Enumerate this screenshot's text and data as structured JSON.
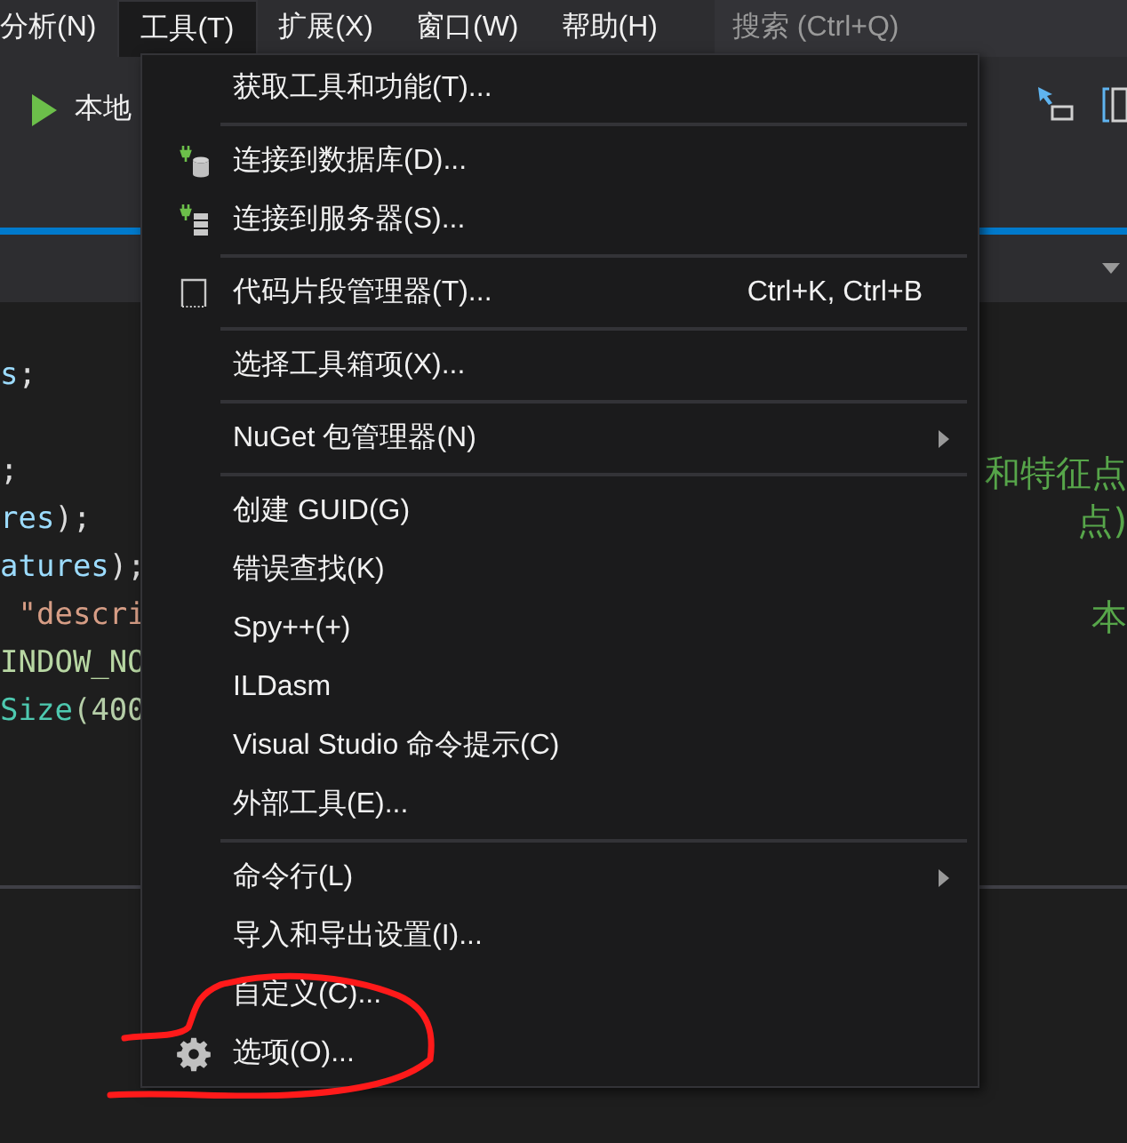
{
  "menubar": {
    "items": [
      {
        "label": "分析(N)",
        "selected": false
      },
      {
        "label": "工具(T)",
        "selected": true
      },
      {
        "label": "扩展(X)",
        "selected": false
      },
      {
        "label": "窗口(W)",
        "selected": false
      },
      {
        "label": "帮助(H)",
        "selected": false
      }
    ],
    "search": {
      "placeholder": "搜索 (Ctrl+Q)"
    }
  },
  "toolbar": {
    "run_label": "本地"
  },
  "editor": {
    "lines": [
      {
        "kind": "code",
        "left": [
          {
            "text": "s",
            "color": "#9cdcfe"
          },
          {
            "text": ";",
            "color": "#dcdcdc"
          }
        ]
      },
      {
        "kind": "blank"
      },
      {
        "kind": "code",
        "left": [
          {
            "text": ";",
            "color": "#dcdcdc"
          }
        ],
        "right": [
          {
            "text": "和特征点",
            "color": "#57a64a"
          }
        ]
      },
      {
        "kind": "code",
        "left": [
          {
            "text": "res",
            "color": "#9cdcfe"
          },
          {
            "text": ");",
            "color": "#dcdcdc"
          }
        ],
        "right": [
          {
            "text": "点)",
            "color": "#57a64a"
          }
        ]
      },
      {
        "kind": "code",
        "left": [
          {
            "text": "atures",
            "color": "#9cdcfe"
          },
          {
            "text": ");",
            "color": "#dcdcdc"
          }
        ]
      },
      {
        "kind": "code",
        "left": [
          {
            "text": " \"descri",
            "color": "#d69d85"
          }
        ],
        "right": [
          {
            "text": "本",
            "color": "#57a64a"
          }
        ]
      },
      {
        "kind": "code",
        "left": [
          {
            "text": "INDOW_NO",
            "color": "#b8d7a3"
          }
        ]
      },
      {
        "kind": "code",
        "left": [
          {
            "text": "Size",
            "color": "#4ec9b0"
          },
          {
            "text": "(400",
            "color": "#b5cea8"
          }
        ]
      }
    ]
  },
  "menu": {
    "groups": [
      [
        {
          "label": "获取工具和功能(T)...",
          "has_submenu": false
        }
      ],
      [
        {
          "label": "连接到数据库(D)...",
          "has_submenu": false
        },
        {
          "label": "连接到服务器(S)...",
          "has_submenu": false
        }
      ],
      [
        {
          "label": "代码片段管理器(T)...",
          "shortcut": "Ctrl+K, Ctrl+B",
          "has_submenu": false
        }
      ],
      [
        {
          "label": "选择工具箱项(X)...",
          "has_submenu": false
        }
      ],
      [
        {
          "label": "NuGet 包管理器(N)",
          "has_submenu": true
        }
      ],
      [
        {
          "label": "创建 GUID(G)",
          "has_submenu": false
        },
        {
          "label": "错误查找(K)",
          "has_submenu": false
        },
        {
          "label": "Spy++(+)",
          "has_submenu": false
        },
        {
          "label": "ILDasm",
          "has_submenu": false
        },
        {
          "label": "Visual Studio 命令提示(C)",
          "has_submenu": false
        },
        {
          "label": "外部工具(E)...",
          "has_submenu": false
        }
      ],
      [
        {
          "label": "命令行(L)",
          "has_submenu": true
        },
        {
          "label": "导入和导出设置(I)...",
          "has_submenu": false
        },
        {
          "label": "自定义(C)...",
          "has_submenu": false
        },
        {
          "label": "选项(O)...",
          "has_submenu": false
        }
      ]
    ]
  }
}
